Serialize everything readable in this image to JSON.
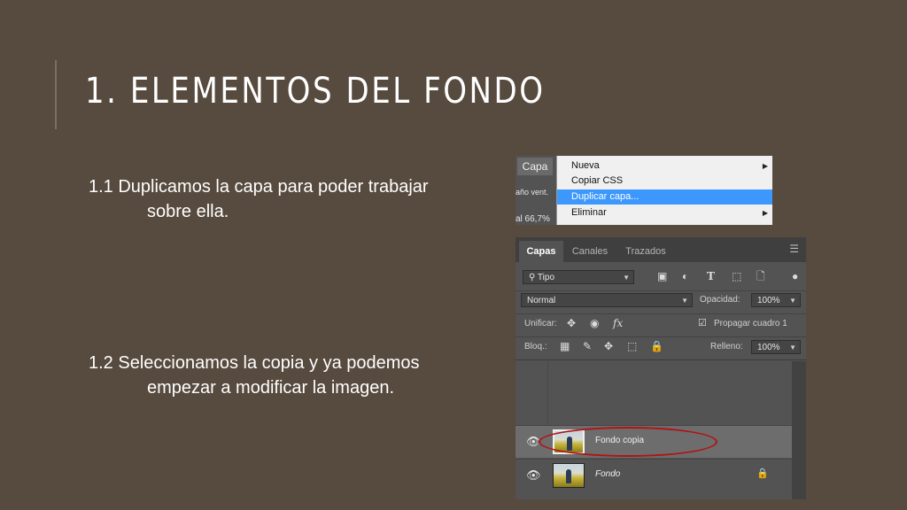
{
  "slide": {
    "title": "1. ELEMENTOS DEL FONDO",
    "bullets": [
      {
        "lead": "1.1 Duplicamos la capa para poder trabajar",
        "cont": "sobre ella."
      },
      {
        "lead": "1.2 Seleccionamos la copia y ya podemos",
        "cont": "empezar a modificar la imagen."
      }
    ]
  },
  "menu": {
    "button_label": "Capa",
    "side_text_1": "año vent.",
    "side_text_2": "al 66,7%",
    "items": [
      {
        "label": "Nueva",
        "submenu": true
      },
      {
        "label": "Copiar CSS",
        "submenu": false
      },
      {
        "label": "Duplicar capa...",
        "submenu": false,
        "selected": true
      },
      {
        "label": "Eliminar",
        "submenu": true
      }
    ]
  },
  "layers_panel": {
    "tabs": [
      "Capas",
      "Canales",
      "Trazados"
    ],
    "active_tab": "Capas",
    "filter_label": "Tipo",
    "blend_mode": "Normal",
    "opacity_label": "Opacidad:",
    "opacity_value": "100%",
    "unify_label": "Unificar:",
    "propagate_label": "Propagar cuadro 1",
    "propagate_checked": true,
    "lock_label": "Bloq.:",
    "fill_label": "Relleno:",
    "fill_value": "100%",
    "layers": [
      {
        "name": "Fondo copia",
        "selected": true,
        "italic": false,
        "locked": false
      },
      {
        "name": "Fondo",
        "selected": false,
        "italic": true,
        "locked": true
      }
    ]
  },
  "colors": {
    "slide_background": "#574a3e",
    "panel_background": "#535353",
    "menu_selection": "#3c98fc",
    "highlight_ellipse": "#b01414"
  }
}
